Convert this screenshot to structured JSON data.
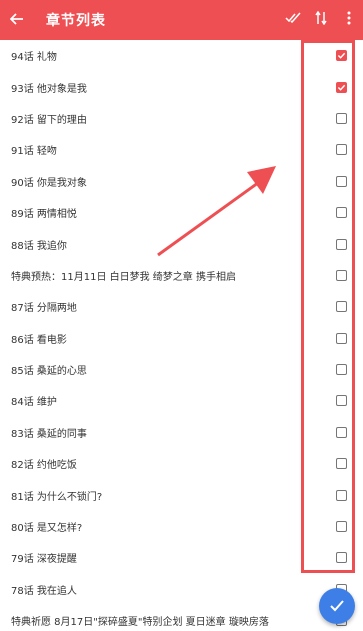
{
  "appbar": {
    "title": "章节列表",
    "back_icon": "arrow-left-icon",
    "actions": [
      "select-all-icon",
      "sort-icon",
      "more-vertical-icon"
    ]
  },
  "accent_color": "#ee4f52",
  "fab_color": "#3d7fe6",
  "chapters": [
    {
      "label": "94话 礼物",
      "checked": true
    },
    {
      "label": "93话 他对象是我",
      "checked": true
    },
    {
      "label": "92话 留下的理由",
      "checked": false
    },
    {
      "label": "91话 轻吻",
      "checked": false
    },
    {
      "label": "90话 你是我对象",
      "checked": false
    },
    {
      "label": "89话 两情相悦",
      "checked": false
    },
    {
      "label": "88话 我追你",
      "checked": false
    },
    {
      "label": "特典预热：11月11日 白日梦我 绮梦之章 携手相启",
      "checked": false
    },
    {
      "label": "87话 分隔两地",
      "checked": false
    },
    {
      "label": "86话 看电影",
      "checked": false
    },
    {
      "label": "85话 桑延的心思",
      "checked": false
    },
    {
      "label": "84话 维护",
      "checked": false
    },
    {
      "label": "83话 桑延的同事",
      "checked": false
    },
    {
      "label": "82话 约他吃饭",
      "checked": false
    },
    {
      "label": "81话 为什么不锁门?",
      "checked": false
    },
    {
      "label": "80话 是又怎样?",
      "checked": false
    },
    {
      "label": "79话 深夜提醒",
      "checked": false
    },
    {
      "label": "78话 我在追人",
      "checked": false
    },
    {
      "label": "特典祈愿 8月17日\"探碎盛夏\"特别企划 夏日迷章 璇映房落",
      "checked": false
    }
  ],
  "fab_icon": "check-icon"
}
